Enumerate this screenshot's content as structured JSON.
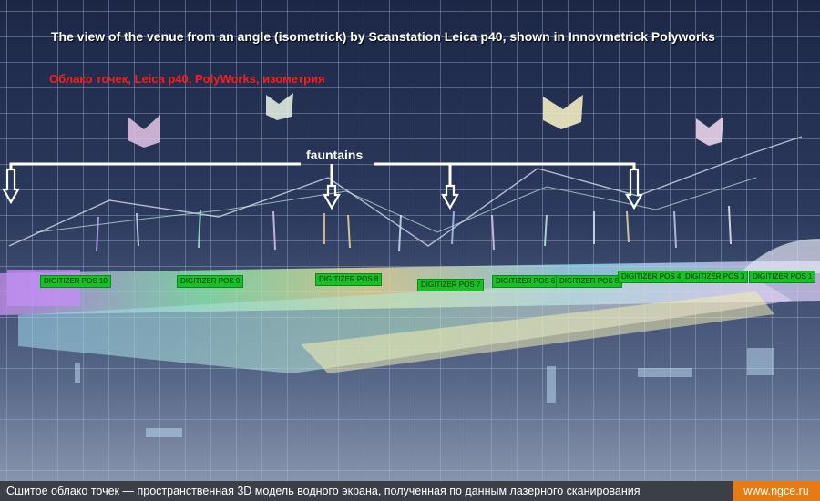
{
  "titles": {
    "english": "The view of the venue from an angle (isometrick) by Scanstation Leica p40, shown in Innovmetrick Polyworks",
    "russian": "Облако точек, Leica p40, PolyWorks, изометрия"
  },
  "annotation": {
    "fountains_label": "fauntains"
  },
  "digitizer_positions": [
    "DIGITIZER POS 10",
    "DIGITIZER POS 9",
    "DIGITIZER POS 8",
    "DIGITIZER POS 7",
    "DIGITIZER POS 6",
    "DIGITIZER POS 5",
    "DIGITIZER POS 4",
    "DIGITIZER POS 3",
    "DIGITIZER POS 1"
  ],
  "footer": {
    "caption": "Сшитое облако точек — пространственная 3D модель водного экрана, полученная по данным лазерного сканирования",
    "site": "www.ngce.ru"
  },
  "colors": {
    "background": "#2a3554",
    "title_text": "#ffffff",
    "russian_title": "#ff1a1a",
    "tag_background": "#16c026",
    "footer_background": "#3b3f47",
    "site_badge": "#e87a12"
  }
}
